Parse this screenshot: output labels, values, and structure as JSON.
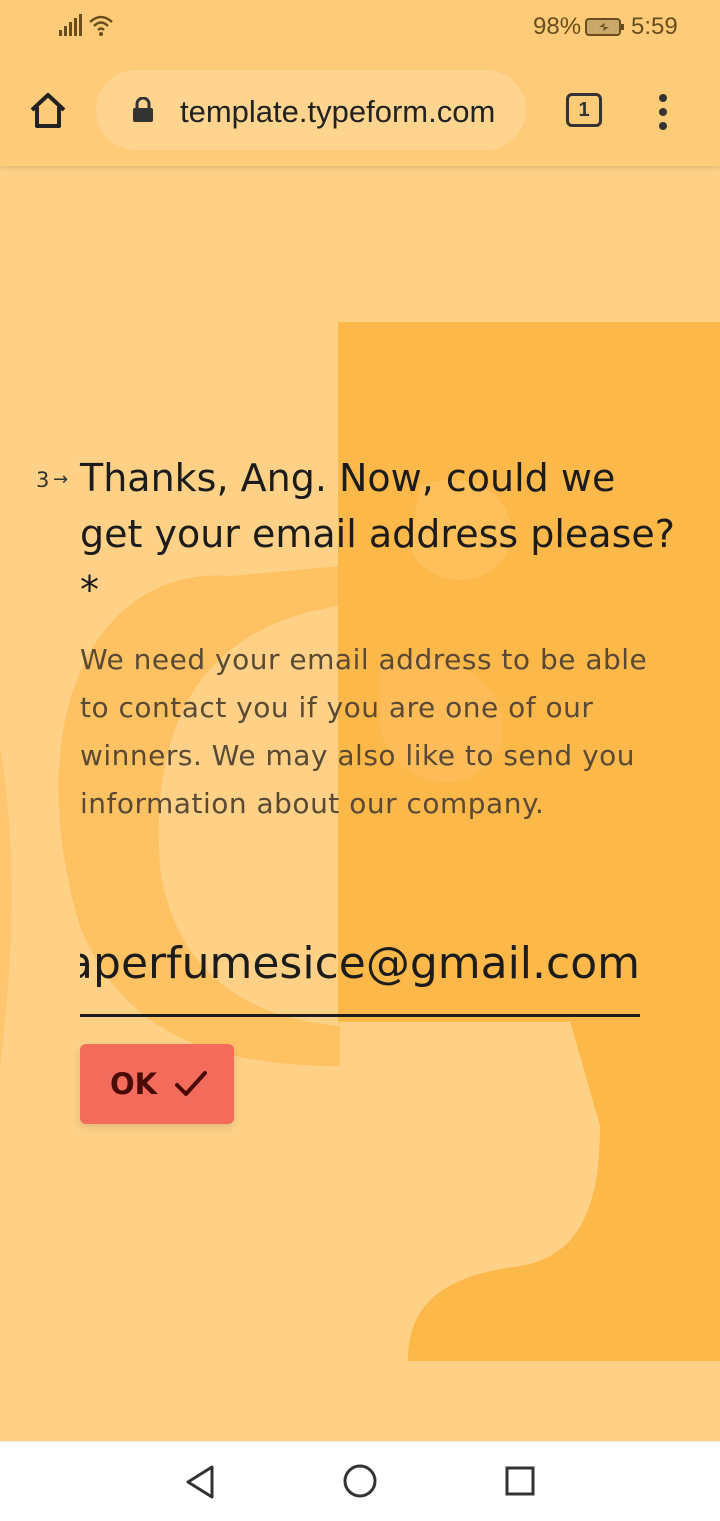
{
  "status_bar": {
    "battery_percent": "98%",
    "time": "5:59",
    "icons": [
      "signal-icon",
      "wifi-icon",
      "battery-icon"
    ]
  },
  "browser": {
    "url": "template.typeform.com",
    "tab_count": "1",
    "icons": [
      "home-icon",
      "lock-icon",
      "tabs-icon",
      "more-vert-icon"
    ]
  },
  "form": {
    "question_number": "3",
    "question_arrow": "→",
    "question": "Thanks, Ang. Now, could we get your email address please? *",
    "description": "We need your email address to be able to contact you if you are one of our winners. We may also like to send you information about our company.",
    "email_value": "angelaperfumesice@gmail.com",
    "ok_label": "OK"
  },
  "colors": {
    "background": "#fed187",
    "toolbar": "#fecb78",
    "trophy": "#fdb84a",
    "ok_button": "#f26b5b"
  },
  "nav_bar": {
    "icons": [
      "back-icon",
      "home-circle-icon",
      "recent-apps-icon"
    ]
  }
}
